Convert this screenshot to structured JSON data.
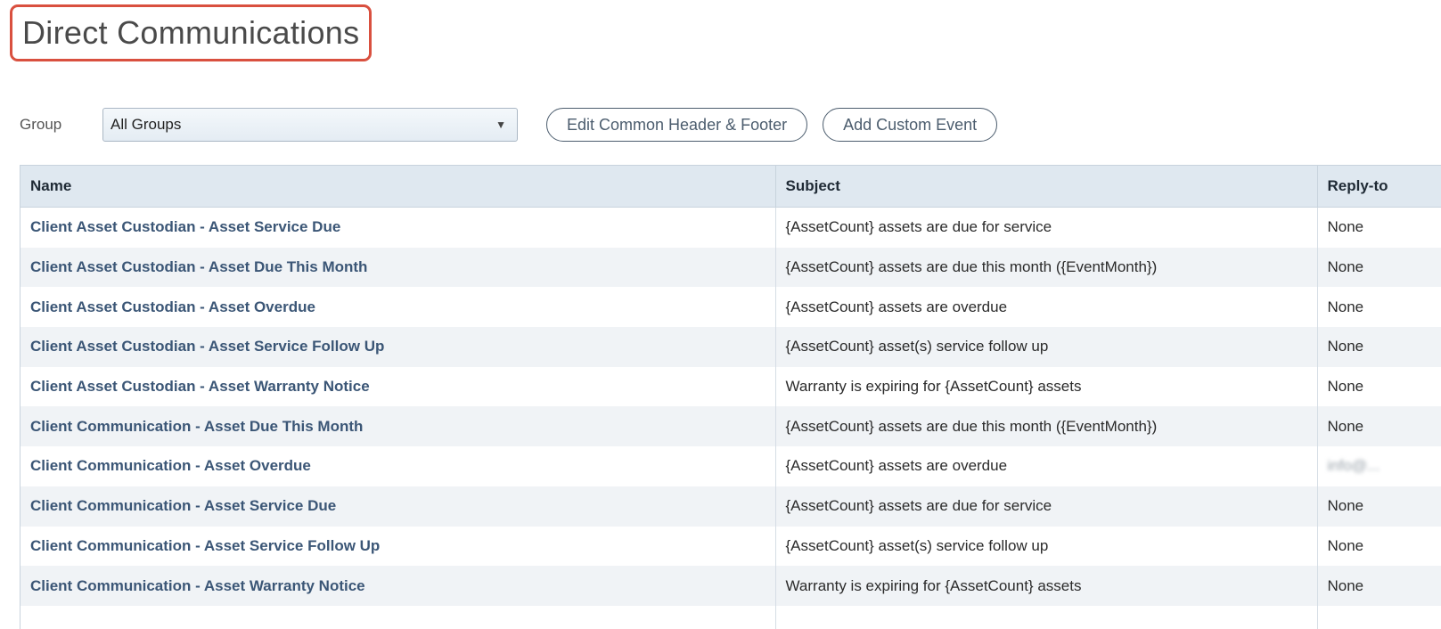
{
  "page": {
    "title": "Direct Communications"
  },
  "toolbar": {
    "group_label": "Group",
    "group_value": "All Groups",
    "edit_header_footer_label": "Edit Common Header & Footer",
    "add_custom_event_label": "Add Custom Event"
  },
  "table": {
    "columns": [
      "Name",
      "Subject",
      "Reply-to"
    ],
    "rows": [
      {
        "name": "Client Asset Custodian - Asset Service Due",
        "subject": "{AssetCount} assets are due for service",
        "reply_to": "None"
      },
      {
        "name": "Client Asset Custodian - Asset Due This Month",
        "subject": "{AssetCount} assets are due this month ({EventMonth})",
        "reply_to": "None"
      },
      {
        "name": "Client Asset Custodian - Asset Overdue",
        "subject": "{AssetCount} assets are overdue",
        "reply_to": "None"
      },
      {
        "name": "Client Asset Custodian - Asset Service Follow Up",
        "subject": "{AssetCount} asset(s) service follow up",
        "reply_to": "None"
      },
      {
        "name": "Client Asset Custodian - Asset Warranty Notice",
        "subject": "Warranty is expiring for {AssetCount} assets",
        "reply_to": "None"
      },
      {
        "name": "Client Communication - Asset Due This Month",
        "subject": "{AssetCount} assets are due this month ({EventMonth})",
        "reply_to": "None"
      },
      {
        "name": "Client Communication - Asset Overdue",
        "subject": "{AssetCount} assets are overdue",
        "reply_to": "info@...",
        "blurred": true
      },
      {
        "name": "Client Communication - Asset Service Due",
        "subject": "{AssetCount} assets are due for service",
        "reply_to": "None"
      },
      {
        "name": "Client Communication - Asset Service Follow Up",
        "subject": "{AssetCount} asset(s) service follow up",
        "reply_to": "None"
      },
      {
        "name": "Client Communication - Asset Warranty Notice",
        "subject": "Warranty is expiring for {AssetCount} assets",
        "reply_to": "None"
      },
      {
        "name": "",
        "subject": "",
        "reply_to": ""
      }
    ]
  },
  "colors": {
    "title_highlight": "#d9503f",
    "header_bg": "#dfe8f0",
    "link": "#3b5676",
    "zebra": "#f0f3f6"
  }
}
